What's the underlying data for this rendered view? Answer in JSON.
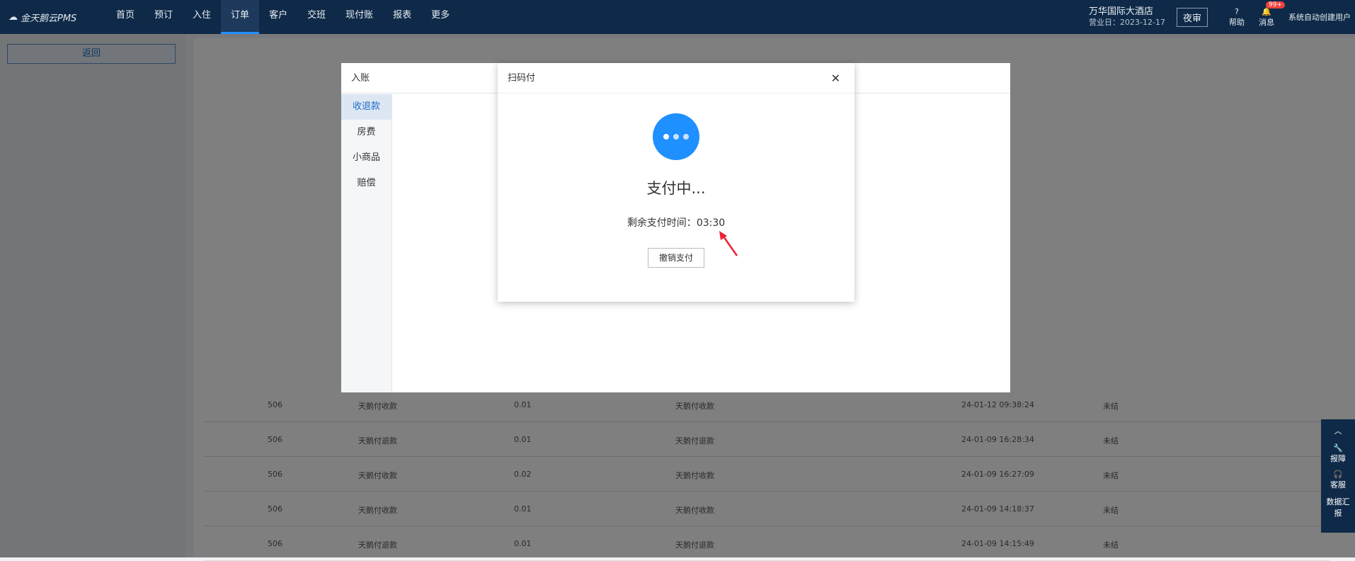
{
  "nav": {
    "logo": "金天鹅云PMS",
    "items": [
      "首页",
      "预订",
      "入住",
      "订单",
      "客户",
      "交班",
      "现付账",
      "报表",
      "更多"
    ],
    "active": "订单"
  },
  "hotel": {
    "name": "万华国际大酒店",
    "date": "营业日：2023-12-17"
  },
  "top": {
    "night": "夜审",
    "help": "帮助",
    "messages": "消息",
    "badge": "99+",
    "user": "系统自动创建用户"
  },
  "left": {
    "back": "返回"
  },
  "modal_ruzhang": {
    "title": "入账",
    "menu": [
      "收退款",
      "房费",
      "小商品",
      "赔偿"
    ]
  },
  "modal_scan": {
    "title": "扫码付",
    "status": "支付中...",
    "time_label": "剩余支付时间：",
    "time": "03:30",
    "cancel": "撤销支付"
  },
  "side": {
    "items": [
      "报障",
      "客服",
      "数据汇报"
    ]
  },
  "rows": [
    {
      "room": "506",
      "item": "天鹅付收款",
      "amount": "0.01",
      "desc": "天鹅付收款",
      "time": "24-01-12 09:38:24",
      "status": "未结"
    },
    {
      "room": "506",
      "item": "天鹅付退款",
      "amount": "0.01",
      "desc": "天鹅付退款",
      "time": "24-01-09 16:28:34",
      "status": "未结"
    },
    {
      "room": "506",
      "item": "天鹅付收款",
      "amount": "0.02",
      "desc": "天鹅付收款",
      "time": "24-01-09 16:27:09",
      "status": "未结"
    },
    {
      "room": "506",
      "item": "天鹅付收款",
      "amount": "0.01",
      "desc": "天鹅付收款",
      "time": "24-01-09 14:18:37",
      "status": "未结"
    },
    {
      "room": "506",
      "item": "天鹅付退款",
      "amount": "0.01",
      "desc": "天鹅付退款",
      "time": "24-01-09 14:15:49",
      "status": "未结"
    }
  ]
}
